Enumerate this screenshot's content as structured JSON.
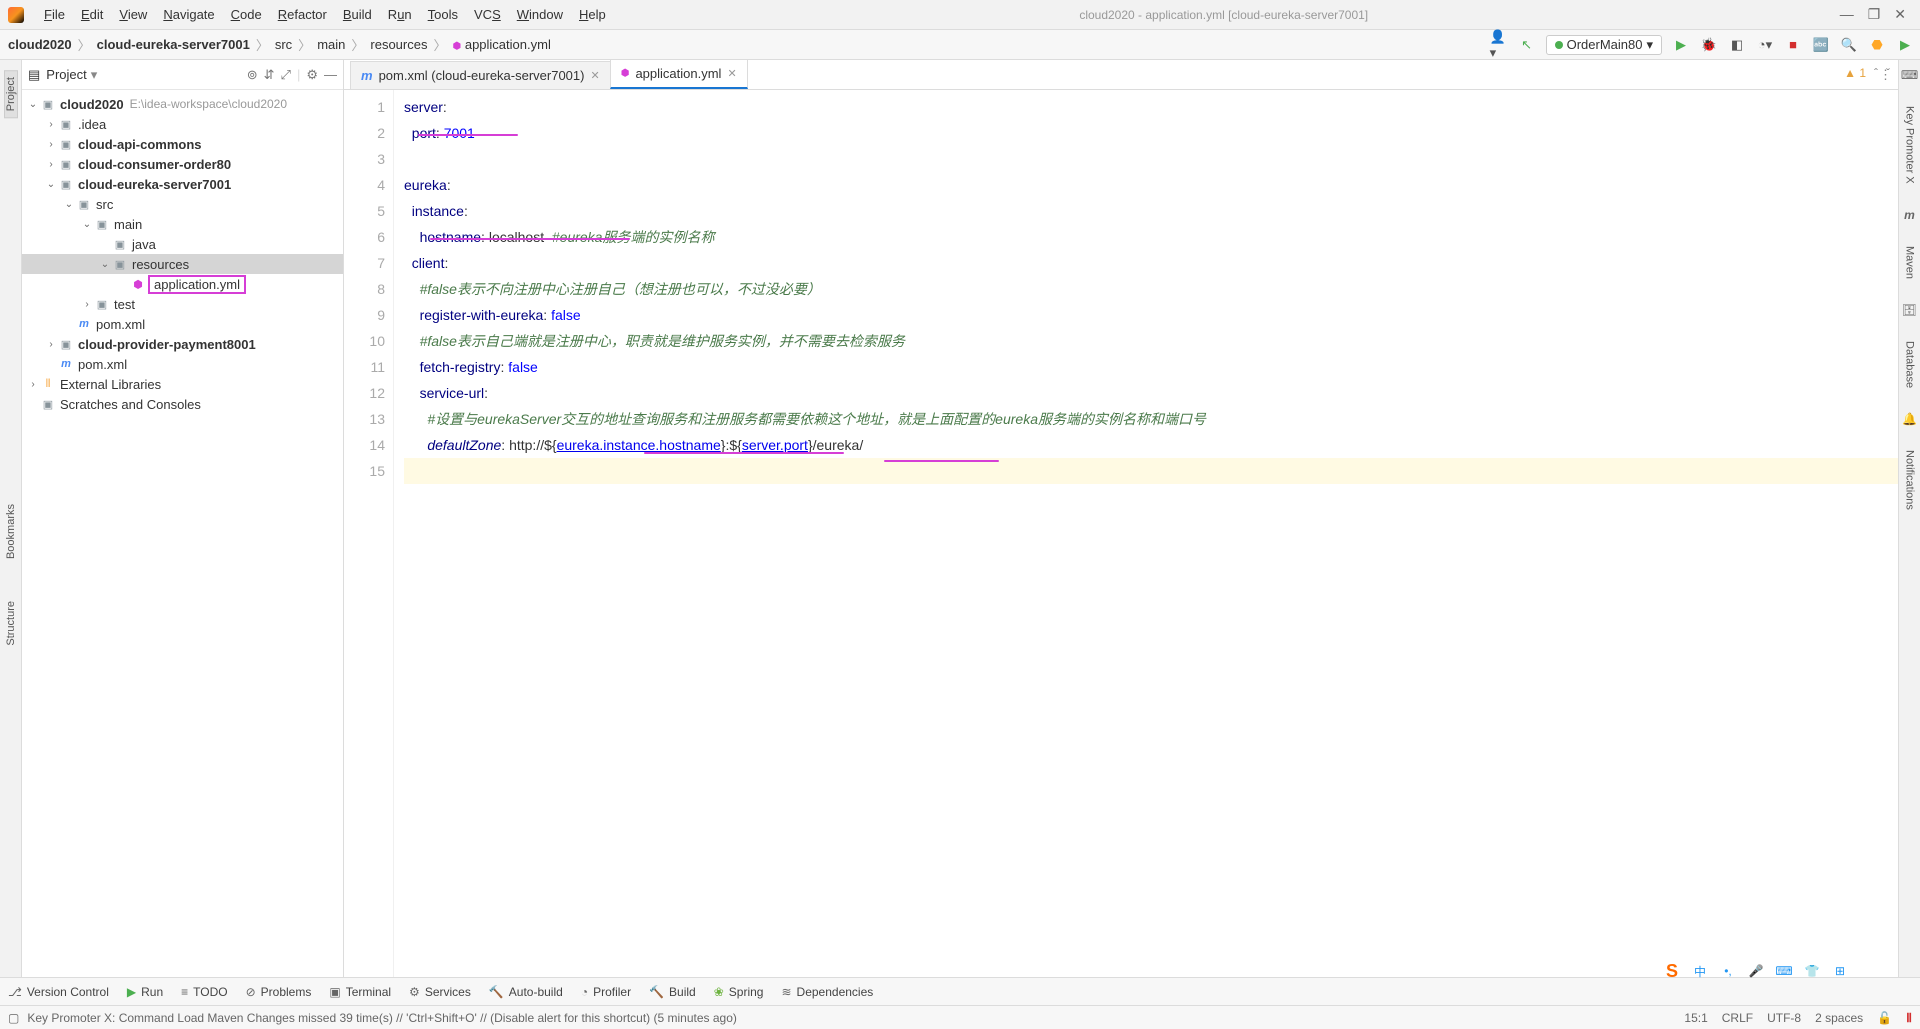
{
  "menu": [
    "File",
    "Edit",
    "View",
    "Navigate",
    "Code",
    "Refactor",
    "Build",
    "Run",
    "Tools",
    "VCS",
    "Window",
    "Help"
  ],
  "window_title": "cloud2020 - application.yml [cloud-eureka-server7001]",
  "breadcrumbs": [
    "cloud2020",
    "cloud-eureka-server7001",
    "src",
    "main",
    "resources",
    "application.yml"
  ],
  "run_config": "OrderMain80",
  "project": {
    "title": "Project",
    "root": {
      "name": "cloud2020",
      "path": "E:\\idea-workspace\\cloud2020"
    },
    "children": [
      {
        "name": ".idea",
        "type": "folder"
      },
      {
        "name": "cloud-api-commons",
        "type": "module"
      },
      {
        "name": "cloud-consumer-order80",
        "type": "module"
      },
      {
        "name": "cloud-eureka-server7001",
        "type": "module",
        "expanded": true,
        "children": [
          {
            "name": "src",
            "type": "folder",
            "expanded": true,
            "children": [
              {
                "name": "main",
                "type": "folder",
                "expanded": true,
                "children": [
                  {
                    "name": "java",
                    "type": "folder"
                  },
                  {
                    "name": "resources",
                    "type": "folder",
                    "expanded": true,
                    "selected": true,
                    "children": [
                      {
                        "name": "application.yml",
                        "type": "yml",
                        "highlighted": true
                      }
                    ]
                  }
                ]
              },
              {
                "name": "test",
                "type": "folder"
              }
            ]
          },
          {
            "name": "pom.xml",
            "type": "pom"
          }
        ]
      },
      {
        "name": "cloud-provider-payment8001",
        "type": "module"
      },
      {
        "name": "pom.xml",
        "type": "pom"
      }
    ],
    "libs": "External Libraries",
    "scratches": "Scratches and Consoles"
  },
  "tabs": [
    {
      "label": "pom.xml (cloud-eureka-server7001)",
      "type": "pom"
    },
    {
      "label": "application.yml",
      "type": "yml",
      "active": true
    }
  ],
  "editor_indicator": {
    "warnings": 1
  },
  "code": {
    "lines": 15,
    "line1": {
      "key": "server",
      "colon": ":"
    },
    "line2": {
      "key": "port",
      "colon": ": ",
      "val": "7001"
    },
    "line4": {
      "key": "eureka",
      "colon": ":"
    },
    "line5": {
      "key": "instance",
      "colon": ":"
    },
    "line6": {
      "key": "hostname",
      "colon": ": ",
      "val": "localhost",
      "comment": "  #eureka服务端的实例名称"
    },
    "line7": {
      "key": "client",
      "colon": ":"
    },
    "line8": {
      "comment": "#false表示不向注册中心注册自己（想注册也可以，不过没必要）"
    },
    "line9": {
      "key": "register-with-eureka",
      "colon": ": ",
      "val": "false"
    },
    "line10": {
      "comment": "#false表示自己端就是注册中心，职责就是维护服务实例，并不需要去检索服务"
    },
    "line11": {
      "key": "fetch-registry",
      "colon": ": ",
      "val": "false"
    },
    "line12": {
      "key": "service-url",
      "colon": ":"
    },
    "line13": {
      "comment": "#设置与eurekaServer交互的地址查询服务和注册服务都需要依赖这个地址，就是上面配置的eureka服务端的实例名称和端口号"
    },
    "line14": {
      "key": "defaultZone",
      "colon": ": ",
      "pre": "http://${",
      "link1": "eureka.instance.hostname",
      "mid": "}:${",
      "link2": "server.port",
      "post": "}/eureka/"
    }
  },
  "right_tools": [
    "Key Promoter X",
    "Maven",
    "Database",
    "Notifications"
  ],
  "left_tools": [
    "Project",
    "Bookmarks",
    "Structure"
  ],
  "bottom_tools": [
    "Version Control",
    "Run",
    "TODO",
    "Problems",
    "Terminal",
    "Services",
    "Auto-build",
    "Profiler",
    "Build",
    "Spring",
    "Dependencies"
  ],
  "status": {
    "msg": "Key Promoter X: Command Load Maven Changes missed 39 time(s) // 'Ctrl+Shift+O' // (Disable alert for this shortcut) (5 minutes ago)",
    "pos": "15:1",
    "le": "CRLF",
    "enc": "UTF-8",
    "indent": "2 spaces"
  }
}
